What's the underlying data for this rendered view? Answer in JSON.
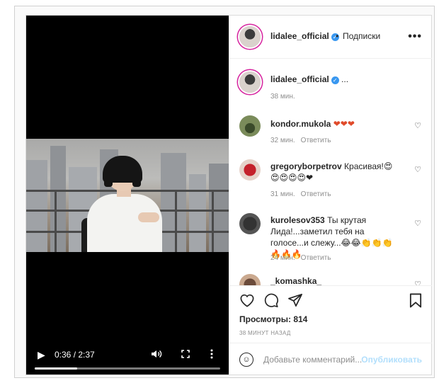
{
  "video": {
    "time": "0:36 / 2:37",
    "progress_fraction": 0.23,
    "play_icon": "play-icon",
    "volume_icon": "volume-icon",
    "fullscreen_icon": "fullscreen-icon",
    "more_icon": "vertical-dots-icon"
  },
  "header": {
    "username": "lidalee_official",
    "dot": "•",
    "follow_status": "Подписки",
    "more": "•••"
  },
  "caption": {
    "username": "lidalee_official",
    "text": "...",
    "time": "38 мин."
  },
  "comments": [
    {
      "username": "kondor.mukola",
      "text": "❤❤❤",
      "time": "32 мин.",
      "reply": "Ответить"
    },
    {
      "username": "gregoryborpetrov",
      "text": "Красивая!😍😍😍😍😍❤",
      "time": "31 мин.",
      "reply": "Ответить"
    },
    {
      "username": "kurolesov353",
      "text": "Ты крутая Лида!...заметил тебя на голосе...и слежу...😂😂👏👏👏🔥🔥🔥",
      "time": "24 мин.",
      "reply": "Ответить"
    },
    {
      "username": "_komashka_",
      "text": "",
      "time": "",
      "reply": ""
    }
  ],
  "actions": {
    "views_label": "Просмотры: 814",
    "ago": "38 МИНУТ НАЗАД"
  },
  "add_comment": {
    "placeholder": "Добавьте комментарий...",
    "publish": "Опубликовать"
  },
  "colors": {
    "verified": "#3897f0",
    "publish": "#b2dffc",
    "story_ring": "#d6249f"
  }
}
